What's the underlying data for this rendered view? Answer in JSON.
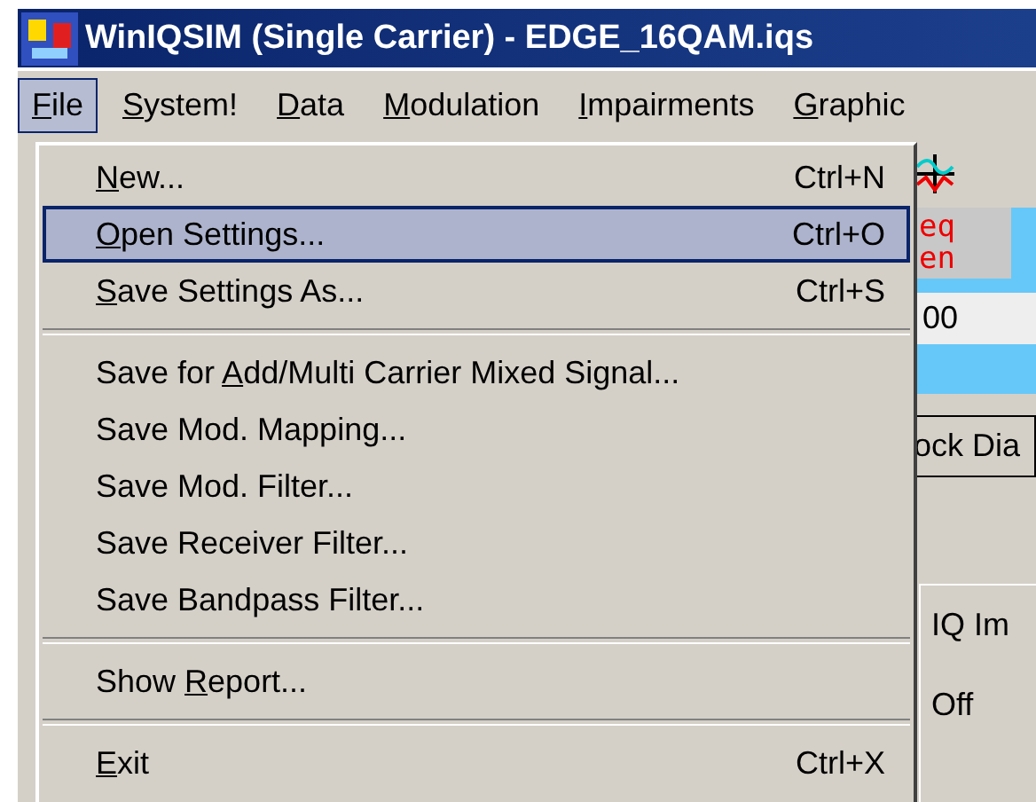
{
  "window": {
    "title": "WinIQSIM (Single Carrier) - EDGE_16QAM.iqs"
  },
  "menu_bar": [
    {
      "key": "F",
      "post": "ile",
      "selected": true
    },
    {
      "key": "S",
      "post": "ystem!",
      "selected": false
    },
    {
      "key": "D",
      "post": "ata",
      "selected": false
    },
    {
      "key": "M",
      "post": "odulation",
      "selected": false
    },
    {
      "key": "I",
      "post": "mpairments",
      "selected": false
    },
    {
      "key": "G",
      "post": "raphic",
      "selected": false
    }
  ],
  "file_menu": [
    {
      "kind": "item",
      "key": "N",
      "post": "ew...",
      "shortcut": "Ctrl+N",
      "selected": false
    },
    {
      "kind": "item",
      "key": "O",
      "post": "pen Settings...",
      "shortcut": "Ctrl+O",
      "selected": true
    },
    {
      "kind": "item",
      "key": "S",
      "post": "ave Settings As...",
      "shortcut": "Ctrl+S",
      "selected": false
    },
    {
      "kind": "separator"
    },
    {
      "kind": "item",
      "pre": "Save for ",
      "key": "A",
      "post": "dd/Multi Carrier Mixed Signal...",
      "selected": false
    },
    {
      "kind": "item",
      "pre": "Save Mod. Mapping...",
      "selected": false
    },
    {
      "kind": "item",
      "pre": "Save Mod. Filter...",
      "selected": false
    },
    {
      "kind": "item",
      "pre": "Save Receiver Filter...",
      "selected": false
    },
    {
      "kind": "item",
      "pre": "Save Bandpass Filter...",
      "selected": false
    },
    {
      "kind": "separator"
    },
    {
      "kind": "item",
      "pre": "Show ",
      "key": "R",
      "post": "eport...",
      "selected": false
    },
    {
      "kind": "separator"
    },
    {
      "kind": "item",
      "key": "E",
      "post": "xit",
      "shortcut": "Ctrl+X",
      "selected": false
    }
  ],
  "background": {
    "red_text": [
      "eq",
      "en"
    ],
    "field_value": "00",
    "tab": "ock Dia",
    "group_title": "IQ Im",
    "group_value": "Off"
  }
}
